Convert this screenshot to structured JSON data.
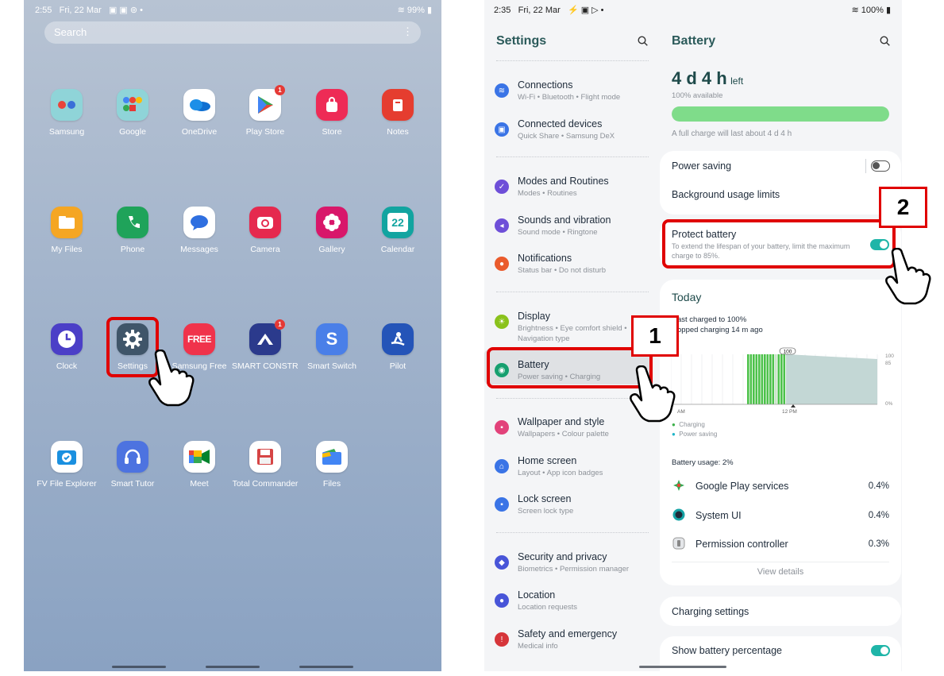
{
  "home": {
    "status_time": "2:55",
    "status_date": "Fri, 22 Mar",
    "status_icons": "▣ ▣ ⊚ •",
    "battery": "99%",
    "search_placeholder": "Search",
    "apps": [
      {
        "label": "Samsung"
      },
      {
        "label": "Google"
      },
      {
        "label": "OneDrive"
      },
      {
        "label": "Play Store",
        "badge": "1"
      },
      {
        "label": "Store"
      },
      {
        "label": "Notes"
      },
      {
        "label": "My Files"
      },
      {
        "label": "Phone"
      },
      {
        "label": "Messages"
      },
      {
        "label": "Camera"
      },
      {
        "label": "Gallery"
      },
      {
        "label": "Calendar",
        "icon_text": "22"
      },
      {
        "label": "Clock"
      },
      {
        "label": "Settings"
      },
      {
        "label": "Samsung Free",
        "icon_text": "FREE"
      },
      {
        "label": "SMART CONSTR...",
        "badge": "1"
      },
      {
        "label": "Smart Switch"
      },
      {
        "label": "Pilot"
      },
      {
        "label": "FV File Explorer"
      },
      {
        "label": "Smart Tutor"
      },
      {
        "label": "Meet"
      },
      {
        "label": "Total Commander"
      },
      {
        "label": "Files"
      }
    ]
  },
  "settings": {
    "status_time": "2:35",
    "status_date": "Fri, 22 Mar",
    "status_icons": "⚡ ▣ ▷ •",
    "battery": "100%",
    "title": "Settings",
    "items": [
      {
        "title": "Connections",
        "sub": "Wi-Fi  •  Bluetooth  •  Flight mode"
      },
      {
        "title": "Connected devices",
        "sub": "Quick Share  •  Samsung DeX"
      },
      {
        "title": "Modes and Routines",
        "sub": "Modes  •  Routines"
      },
      {
        "title": "Sounds and vibration",
        "sub": "Sound mode  •  Ringtone"
      },
      {
        "title": "Notifications",
        "sub": "Status bar  •  Do not disturb"
      },
      {
        "title": "Display",
        "sub": "Brightness  •  Eye comfort shield  •  Navigation type"
      },
      {
        "title": "Battery",
        "sub": "Power saving  •  Charging"
      },
      {
        "title": "Wallpaper and style",
        "sub": "Wallpapers  •  Colour palette"
      },
      {
        "title": "Home screen",
        "sub": "Layout  •  App icon badges"
      },
      {
        "title": "Lock screen",
        "sub": "Screen lock type"
      },
      {
        "title": "Security and privacy",
        "sub": "Biometrics  •  Permission manager"
      },
      {
        "title": "Location",
        "sub": "Location requests"
      },
      {
        "title": "Safety and emergency",
        "sub": "Medical info"
      }
    ]
  },
  "battery": {
    "title": "Battery",
    "time_left": "4 d 4 h",
    "left_label": "left",
    "available": "100% available",
    "level": 1.0,
    "full_charge_note": "A full charge will last about 4 d 4 h",
    "power_saving": "Power saving",
    "background_limits": "Background usage limits",
    "protect_title": "Protect battery",
    "protect_desc": "To extend the lifespan of your battery, limit the maximum charge to 85%.",
    "today": "Today",
    "last_charged": "ast charged to 100%",
    "stopped_charging": "opped charging 14 m ago",
    "chart_peak_label": "100",
    "y_ticks": [
      "100",
      "85",
      "0%"
    ],
    "x_ticks": [
      "AM",
      "12 PM"
    ],
    "legend_charging": "Charging",
    "legend_power_saving": "Power saving",
    "usage_label": "Battery usage: 2%",
    "usage": [
      {
        "name": "Google Play services",
        "pct": "0.4%"
      },
      {
        "name": "System UI",
        "pct": "0.4%"
      },
      {
        "name": "Permission controller",
        "pct": "0.3%"
      }
    ],
    "view_details": "View details",
    "charging_settings": "Charging settings",
    "show_percentage": "Show battery percentage"
  },
  "annotations": {
    "step1": "1",
    "step2": "2"
  },
  "colors": {
    "accent": "#1fb5a8",
    "battery_bar": "#7fdc8a",
    "highlight": "#e00000"
  }
}
